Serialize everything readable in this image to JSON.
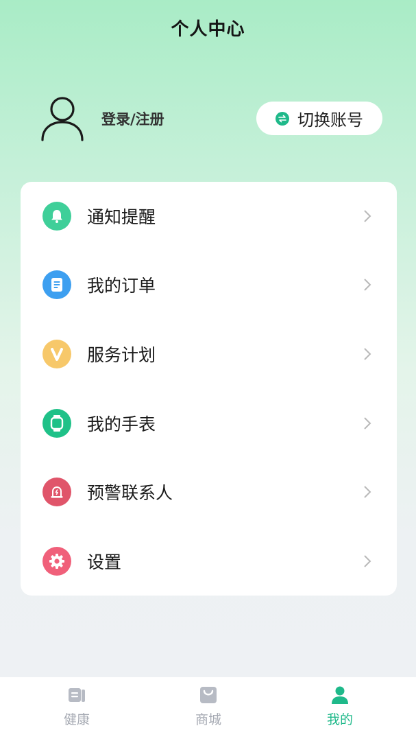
{
  "header": {
    "title": "个人中心"
  },
  "profile": {
    "login_label": "登录/注册"
  },
  "switch_account": {
    "label": "切换账号"
  },
  "menu": {
    "items": [
      {
        "label": "通知提醒",
        "icon": "bell-icon",
        "color": "#3fcf99"
      },
      {
        "label": "我的订单",
        "icon": "order-document-icon",
        "color": "#3d9ff0"
      },
      {
        "label": "服务计划",
        "icon": "vip-v-icon",
        "color": "#f7c86a"
      },
      {
        "label": "我的手表",
        "icon": "watch-icon",
        "color": "#1fc188"
      },
      {
        "label": "预警联系人",
        "icon": "alarm-light-icon",
        "color": "#e0556a"
      },
      {
        "label": "设置",
        "icon": "gear-icon",
        "color": "#f0607a"
      }
    ]
  },
  "tabbar": {
    "tabs": [
      {
        "label": "健康",
        "icon": "health-news-icon",
        "active": false
      },
      {
        "label": "商城",
        "icon": "shopping-bag-icon",
        "active": false
      },
      {
        "label": "我的",
        "icon": "person-icon",
        "active": true
      }
    ],
    "active_color": "#1fb98a",
    "inactive_color": "#a6aab3"
  }
}
